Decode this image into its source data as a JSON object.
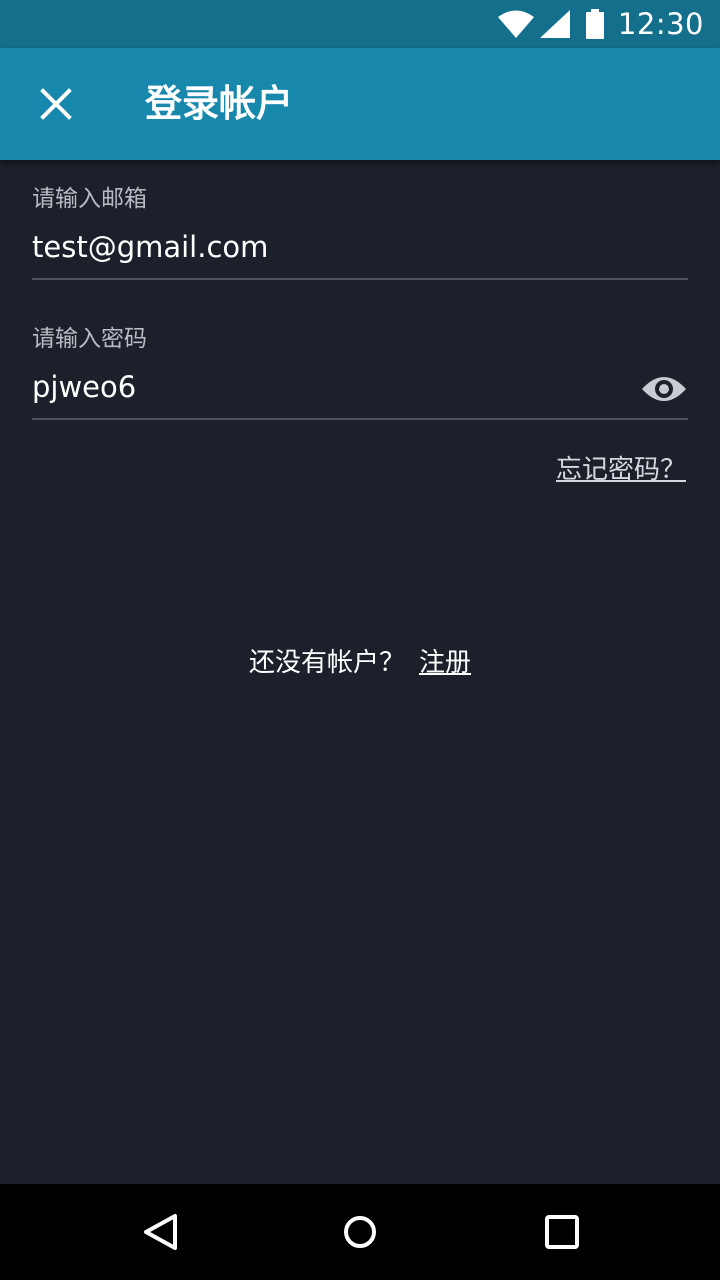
{
  "status_bar": {
    "time": "12:30",
    "icons": [
      "wifi-icon",
      "signal-icon",
      "battery-icon"
    ]
  },
  "app_bar": {
    "title": "登录帐户",
    "close_icon": "close-icon"
  },
  "form": {
    "email": {
      "label": "请输入邮箱",
      "value": "test@gmail.com"
    },
    "password": {
      "label": "请输入密码",
      "value": "pjweo6",
      "toggle_icon": "eye-icon"
    },
    "forgot_link": "忘记密码？"
  },
  "signup": {
    "prompt": "还没有帐户？",
    "link": "注册"
  },
  "nav_bar": {
    "buttons": [
      "back-icon",
      "home-icon",
      "recents-icon"
    ]
  },
  "colors": {
    "status_bar": "#146f8d",
    "app_bar": "#1787ac",
    "background": "#1b202a",
    "nav_bar": "#000000"
  }
}
